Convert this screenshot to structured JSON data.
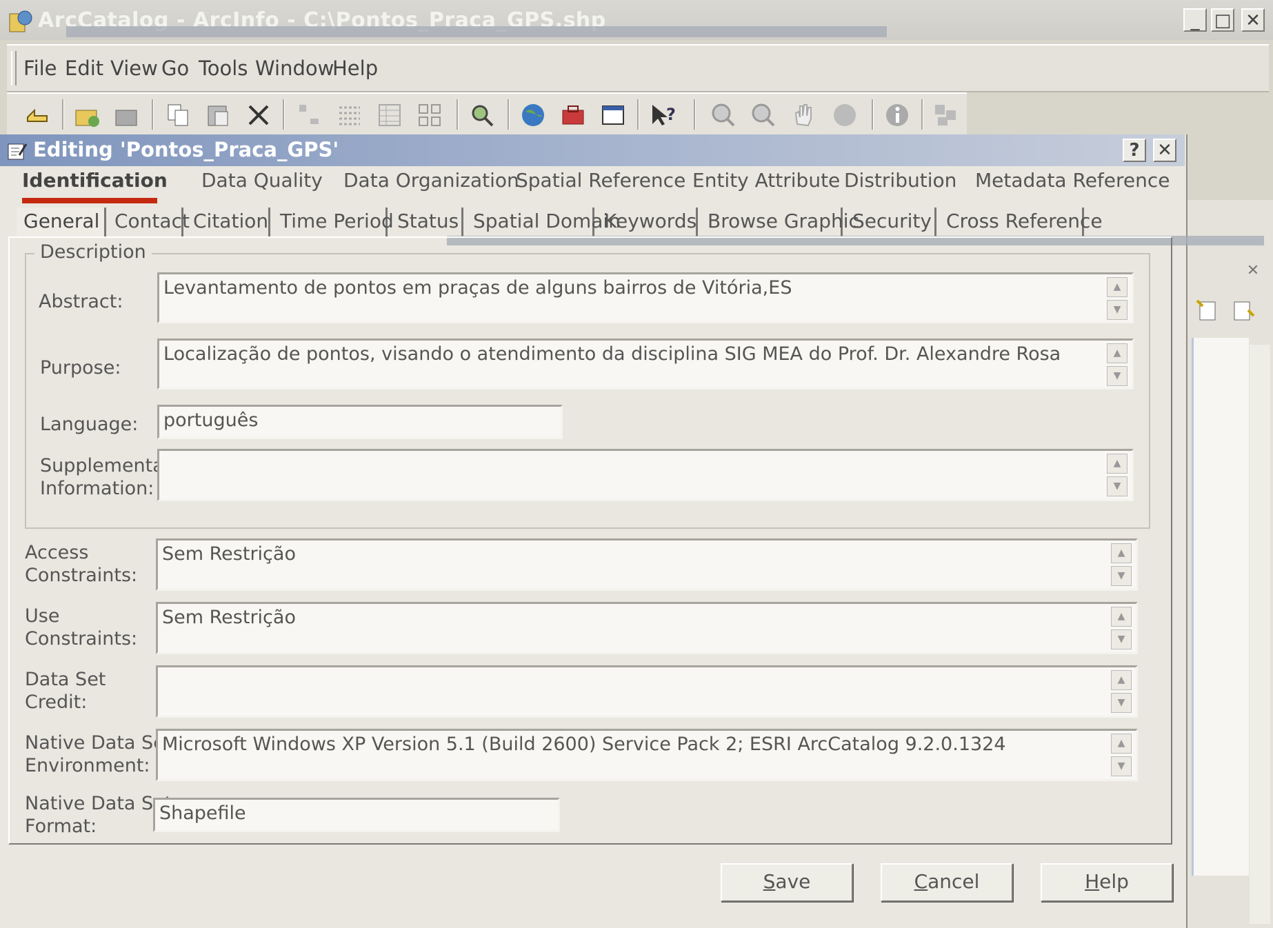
{
  "app": {
    "title": "ArcCatalog - ArcInfo - C:\\Pontos_Praca_GPS.shp",
    "window_buttons": [
      "_",
      "□",
      "✕"
    ]
  },
  "menu": {
    "items": [
      {
        "label": "File"
      },
      {
        "label": "Edit"
      },
      {
        "label": "View"
      },
      {
        "label": "Go"
      },
      {
        "label": "Tools"
      },
      {
        "label": "Window"
      },
      {
        "label": "Help"
      }
    ]
  },
  "toolbar": {
    "icons": [
      "up-one-level-icon",
      "connect-folder-icon",
      "disconnect-folder-icon",
      "copy-icon",
      "paste-icon",
      "delete-icon",
      "large-icons-icon",
      "list-icon",
      "details-icon",
      "thumbnails-icon",
      "search-icon",
      "launch-arcmap-icon",
      "arctoolbox-icon",
      "command-line-icon",
      "whats-this-icon",
      "zoom-in-icon",
      "zoom-out-icon",
      "pan-icon",
      "full-extent-icon",
      "identify-icon",
      "create-thumbnail-icon"
    ]
  },
  "dialog": {
    "title": "Editing 'Pontos_Praca_GPS'",
    "help_btn": "?",
    "close_btn": "✕",
    "main_tabs": [
      {
        "label": "Identification",
        "active": true
      },
      {
        "label": "Data Quality"
      },
      {
        "label": "Data Organization"
      },
      {
        "label": "Spatial Reference"
      },
      {
        "label": "Entity Attribute"
      },
      {
        "label": "Distribution"
      },
      {
        "label": "Metadata Reference"
      }
    ],
    "sub_tabs": [
      {
        "label": "General",
        "active": true
      },
      {
        "label": "Contact"
      },
      {
        "label": "Citation"
      },
      {
        "label": "Time Period"
      },
      {
        "label": "Status"
      },
      {
        "label": "Spatial Domain"
      },
      {
        "label": "Keywords"
      },
      {
        "label": "Browse Graphic"
      },
      {
        "label": "Security"
      },
      {
        "label": "Cross Reference"
      }
    ],
    "description_group": "Description",
    "fields": {
      "abstract": {
        "label": "Abstract:",
        "value": "Levantamento de pontos em praças de alguns bairros de Vitória,ES"
      },
      "purpose": {
        "label": "Purpose:",
        "value": "Localização de pontos, visando o atendimento da disciplina SIG MEA do Prof. Dr. Alexandre Rosa"
      },
      "language": {
        "label": "Language:",
        "value": "português"
      },
      "supplemental": {
        "label1": "Supplemental",
        "label2": "Information:",
        "value": ""
      },
      "access": {
        "label1": "Access",
        "label2": "Constraints:",
        "value": "Sem Restrição"
      },
      "use": {
        "label1": "Use",
        "label2": "Constraints:",
        "value": "Sem Restrição"
      },
      "credit": {
        "label1": "Data Set",
        "label2": "Credit:",
        "value": ""
      },
      "environment": {
        "label1": "Native Data Set",
        "label2": "Environment:",
        "value": "Microsoft Windows XP Version 5.1 (Build 2600) Service Pack 2; ESRI ArcCatalog 9.2.0.1324"
      },
      "format": {
        "label1": "Native Data Set",
        "label2": "Format:",
        "value": "Shapefile"
      }
    },
    "buttons": {
      "save_u": "S",
      "save_rest": "ave",
      "cancel_u": "C",
      "cancel_rest": "ancel",
      "help_u": "H",
      "help_rest": "elp"
    }
  },
  "colors": {
    "dialog_title_start": "#7f95bd",
    "active_tab_underline": "#c42a10",
    "dialog_bg": "#e9e7df"
  }
}
